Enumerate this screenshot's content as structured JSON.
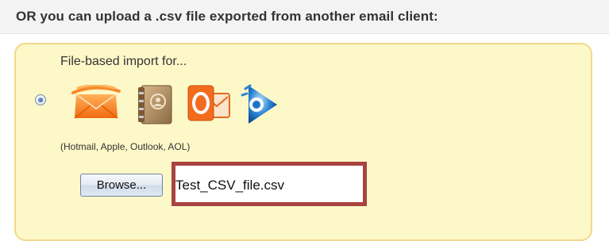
{
  "heading": "OR you can upload a .csv file exported from another email client:",
  "import_panel": {
    "title": "File-based import for...",
    "radio_selected": true,
    "providers": [
      {
        "icon": "hotmail-icon"
      },
      {
        "icon": "apple-address-book-icon"
      },
      {
        "icon": "outlook-icon"
      },
      {
        "icon": "aol-icon"
      }
    ],
    "caption": "(Hotmail, Apple, Outlook, AOL)",
    "browse_label": "Browse...",
    "file_name": "Test_CSV_file.csv"
  },
  "colors": {
    "panel_background": "#fdf8c8",
    "panel_border": "#f1d98a",
    "highlight_border": "#a8433f",
    "hotmail_orange": "#f47a20",
    "outlook_orange": "#f0651e",
    "aol_blue": "#1b73c9"
  }
}
